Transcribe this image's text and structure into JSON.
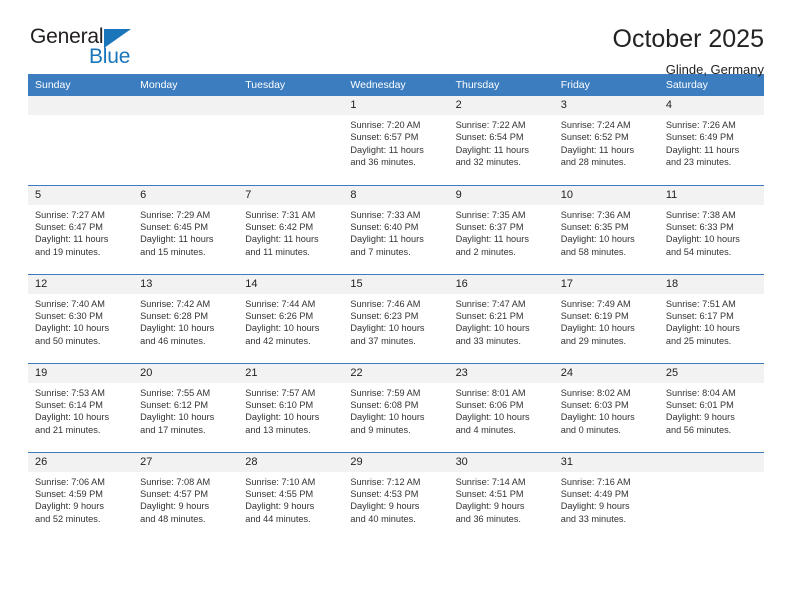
{
  "brand": {
    "name_top": "General",
    "name_bottom": "Blue",
    "triangle_color": "#1b75bb",
    "text_color": "#231f20"
  },
  "header": {
    "title": "October 2025",
    "subtitle": "Glinde, Germany"
  },
  "colors": {
    "header_row_bg": "#3c7dc0",
    "header_row_text": "#ffffff",
    "daynum_bg": "#f2f2f2",
    "week_separator": "#3c7dc0",
    "body_text": "#333333"
  },
  "weekday_headers": [
    "Sunday",
    "Monday",
    "Tuesday",
    "Wednesday",
    "Thursday",
    "Friday",
    "Saturday"
  ],
  "labels": {
    "sunrise_prefix": "Sunrise:",
    "sunset_prefix": "Sunset:",
    "daylight_prefix": "Daylight:"
  },
  "weeks": [
    [
      {
        "day": "",
        "empty": true,
        "sunrise": "",
        "sunset": "",
        "daylight_line1": "",
        "daylight_line2": ""
      },
      {
        "day": "",
        "empty": true,
        "sunrise": "",
        "sunset": "",
        "daylight_line1": "",
        "daylight_line2": ""
      },
      {
        "day": "",
        "empty": true,
        "sunrise": "",
        "sunset": "",
        "daylight_line1": "",
        "daylight_line2": ""
      },
      {
        "day": "1",
        "empty": false,
        "sunrise": "Sunrise: 7:20 AM",
        "sunset": "Sunset: 6:57 PM",
        "daylight_line1": "Daylight: 11 hours",
        "daylight_line2": "and 36 minutes."
      },
      {
        "day": "2",
        "empty": false,
        "sunrise": "Sunrise: 7:22 AM",
        "sunset": "Sunset: 6:54 PM",
        "daylight_line1": "Daylight: 11 hours",
        "daylight_line2": "and 32 minutes."
      },
      {
        "day": "3",
        "empty": false,
        "sunrise": "Sunrise: 7:24 AM",
        "sunset": "Sunset: 6:52 PM",
        "daylight_line1": "Daylight: 11 hours",
        "daylight_line2": "and 28 minutes."
      },
      {
        "day": "4",
        "empty": false,
        "sunrise": "Sunrise: 7:26 AM",
        "sunset": "Sunset: 6:49 PM",
        "daylight_line1": "Daylight: 11 hours",
        "daylight_line2": "and 23 minutes."
      }
    ],
    [
      {
        "day": "5",
        "empty": false,
        "sunrise": "Sunrise: 7:27 AM",
        "sunset": "Sunset: 6:47 PM",
        "daylight_line1": "Daylight: 11 hours",
        "daylight_line2": "and 19 minutes."
      },
      {
        "day": "6",
        "empty": false,
        "sunrise": "Sunrise: 7:29 AM",
        "sunset": "Sunset: 6:45 PM",
        "daylight_line1": "Daylight: 11 hours",
        "daylight_line2": "and 15 minutes."
      },
      {
        "day": "7",
        "empty": false,
        "sunrise": "Sunrise: 7:31 AM",
        "sunset": "Sunset: 6:42 PM",
        "daylight_line1": "Daylight: 11 hours",
        "daylight_line2": "and 11 minutes."
      },
      {
        "day": "8",
        "empty": false,
        "sunrise": "Sunrise: 7:33 AM",
        "sunset": "Sunset: 6:40 PM",
        "daylight_line1": "Daylight: 11 hours",
        "daylight_line2": "and 7 minutes."
      },
      {
        "day": "9",
        "empty": false,
        "sunrise": "Sunrise: 7:35 AM",
        "sunset": "Sunset: 6:37 PM",
        "daylight_line1": "Daylight: 11 hours",
        "daylight_line2": "and 2 minutes."
      },
      {
        "day": "10",
        "empty": false,
        "sunrise": "Sunrise: 7:36 AM",
        "sunset": "Sunset: 6:35 PM",
        "daylight_line1": "Daylight: 10 hours",
        "daylight_line2": "and 58 minutes."
      },
      {
        "day": "11",
        "empty": false,
        "sunrise": "Sunrise: 7:38 AM",
        "sunset": "Sunset: 6:33 PM",
        "daylight_line1": "Daylight: 10 hours",
        "daylight_line2": "and 54 minutes."
      }
    ],
    [
      {
        "day": "12",
        "empty": false,
        "sunrise": "Sunrise: 7:40 AM",
        "sunset": "Sunset: 6:30 PM",
        "daylight_line1": "Daylight: 10 hours",
        "daylight_line2": "and 50 minutes."
      },
      {
        "day": "13",
        "empty": false,
        "sunrise": "Sunrise: 7:42 AM",
        "sunset": "Sunset: 6:28 PM",
        "daylight_line1": "Daylight: 10 hours",
        "daylight_line2": "and 46 minutes."
      },
      {
        "day": "14",
        "empty": false,
        "sunrise": "Sunrise: 7:44 AM",
        "sunset": "Sunset: 6:26 PM",
        "daylight_line1": "Daylight: 10 hours",
        "daylight_line2": "and 42 minutes."
      },
      {
        "day": "15",
        "empty": false,
        "sunrise": "Sunrise: 7:46 AM",
        "sunset": "Sunset: 6:23 PM",
        "daylight_line1": "Daylight: 10 hours",
        "daylight_line2": "and 37 minutes."
      },
      {
        "day": "16",
        "empty": false,
        "sunrise": "Sunrise: 7:47 AM",
        "sunset": "Sunset: 6:21 PM",
        "daylight_line1": "Daylight: 10 hours",
        "daylight_line2": "and 33 minutes."
      },
      {
        "day": "17",
        "empty": false,
        "sunrise": "Sunrise: 7:49 AM",
        "sunset": "Sunset: 6:19 PM",
        "daylight_line1": "Daylight: 10 hours",
        "daylight_line2": "and 29 minutes."
      },
      {
        "day": "18",
        "empty": false,
        "sunrise": "Sunrise: 7:51 AM",
        "sunset": "Sunset: 6:17 PM",
        "daylight_line1": "Daylight: 10 hours",
        "daylight_line2": "and 25 minutes."
      }
    ],
    [
      {
        "day": "19",
        "empty": false,
        "sunrise": "Sunrise: 7:53 AM",
        "sunset": "Sunset: 6:14 PM",
        "daylight_line1": "Daylight: 10 hours",
        "daylight_line2": "and 21 minutes."
      },
      {
        "day": "20",
        "empty": false,
        "sunrise": "Sunrise: 7:55 AM",
        "sunset": "Sunset: 6:12 PM",
        "daylight_line1": "Daylight: 10 hours",
        "daylight_line2": "and 17 minutes."
      },
      {
        "day": "21",
        "empty": false,
        "sunrise": "Sunrise: 7:57 AM",
        "sunset": "Sunset: 6:10 PM",
        "daylight_line1": "Daylight: 10 hours",
        "daylight_line2": "and 13 minutes."
      },
      {
        "day": "22",
        "empty": false,
        "sunrise": "Sunrise: 7:59 AM",
        "sunset": "Sunset: 6:08 PM",
        "daylight_line1": "Daylight: 10 hours",
        "daylight_line2": "and 9 minutes."
      },
      {
        "day": "23",
        "empty": false,
        "sunrise": "Sunrise: 8:01 AM",
        "sunset": "Sunset: 6:06 PM",
        "daylight_line1": "Daylight: 10 hours",
        "daylight_line2": "and 4 minutes."
      },
      {
        "day": "24",
        "empty": false,
        "sunrise": "Sunrise: 8:02 AM",
        "sunset": "Sunset: 6:03 PM",
        "daylight_line1": "Daylight: 10 hours",
        "daylight_line2": "and 0 minutes."
      },
      {
        "day": "25",
        "empty": false,
        "sunrise": "Sunrise: 8:04 AM",
        "sunset": "Sunset: 6:01 PM",
        "daylight_line1": "Daylight: 9 hours",
        "daylight_line2": "and 56 minutes."
      }
    ],
    [
      {
        "day": "26",
        "empty": false,
        "sunrise": "Sunrise: 7:06 AM",
        "sunset": "Sunset: 4:59 PM",
        "daylight_line1": "Daylight: 9 hours",
        "daylight_line2": "and 52 minutes."
      },
      {
        "day": "27",
        "empty": false,
        "sunrise": "Sunrise: 7:08 AM",
        "sunset": "Sunset: 4:57 PM",
        "daylight_line1": "Daylight: 9 hours",
        "daylight_line2": "and 48 minutes."
      },
      {
        "day": "28",
        "empty": false,
        "sunrise": "Sunrise: 7:10 AM",
        "sunset": "Sunset: 4:55 PM",
        "daylight_line1": "Daylight: 9 hours",
        "daylight_line2": "and 44 minutes."
      },
      {
        "day": "29",
        "empty": false,
        "sunrise": "Sunrise: 7:12 AM",
        "sunset": "Sunset: 4:53 PM",
        "daylight_line1": "Daylight: 9 hours",
        "daylight_line2": "and 40 minutes."
      },
      {
        "day": "30",
        "empty": false,
        "sunrise": "Sunrise: 7:14 AM",
        "sunset": "Sunset: 4:51 PM",
        "daylight_line1": "Daylight: 9 hours",
        "daylight_line2": "and 36 minutes."
      },
      {
        "day": "31",
        "empty": false,
        "sunrise": "Sunrise: 7:16 AM",
        "sunset": "Sunset: 4:49 PM",
        "daylight_line1": "Daylight: 9 hours",
        "daylight_line2": "and 33 minutes."
      },
      {
        "day": "",
        "empty": true,
        "sunrise": "",
        "sunset": "",
        "daylight_line1": "",
        "daylight_line2": ""
      }
    ]
  ]
}
